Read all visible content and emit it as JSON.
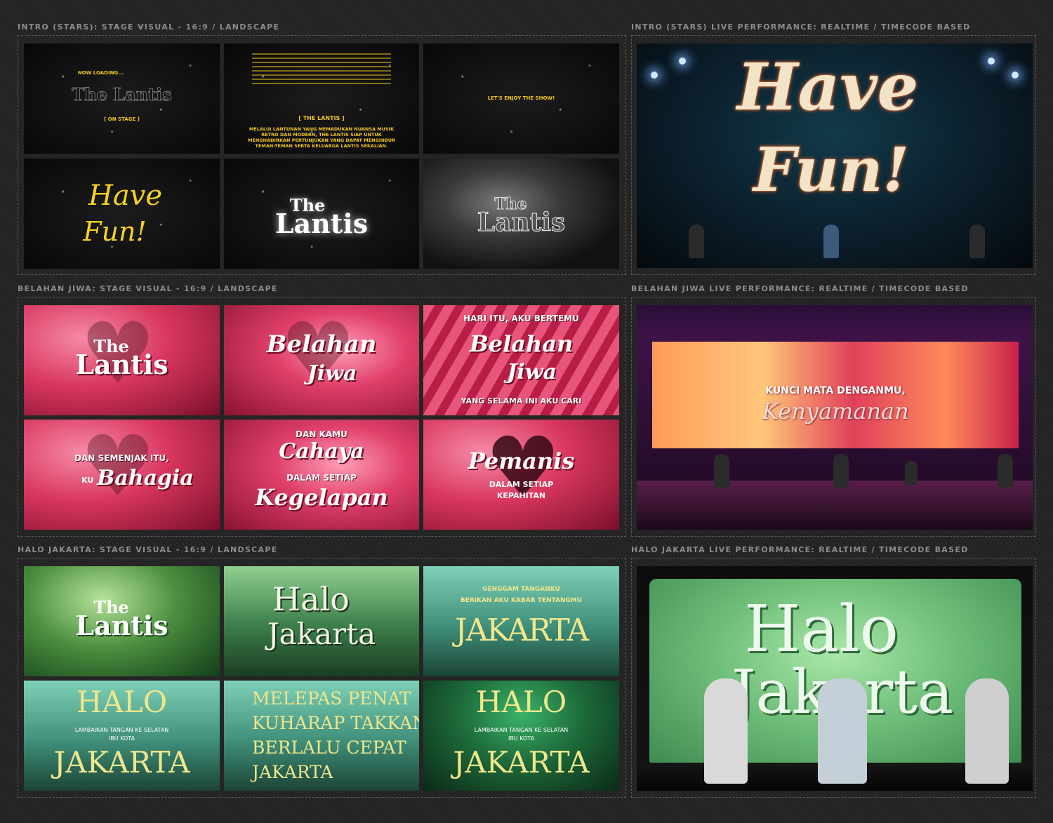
{
  "sections": {
    "intro_stage": "INTRO (STARS): STAGE VISUAL - 16:9 / LANDSCAPE",
    "intro_live": "INTRO (STARS) LIVE PERFORMANCE: REALTIME / TIMECODE BASED",
    "belahan_stage": "BELAHAN JIWA: STAGE VISUAL - 16:9 / LANDSCAPE",
    "belahan_live": "BELAHAN JIWA LIVE PERFORMANCE: REALTIME / TIMECODE BASED",
    "halo_stage": "HALO JAKARTA: STAGE VISUAL - 16:9 / LANDSCAPE",
    "halo_live": "HALO JAKARTA LIVE PERFORMANCE: REALTIME / TIMECODE BASED"
  },
  "intro": {
    "p1": {
      "loading": "NOW LOADING...",
      "logo": "The Lantis",
      "stage": "[ ON STAGE ]"
    },
    "p2": {
      "band": "[ THE LANTIS ]",
      "body": "MELALUI LANTUNAN YANG MEMADUKAN NUANSA MUSIK RETRO DAN MODERN, THE LANTIS SIAP UNTUK MENGHADIRKAN PERTUNJUKAN YANG DAPAT MENGHIBUR TEMAN-TEMAN SERTA KELUARGA LANTIS SEKALIAN."
    },
    "p3": {
      "text": "LET'S ENJOY THE SHOW!"
    },
    "p4": {
      "line1": "Have",
      "line2": "Fun!"
    },
    "p5": {
      "logo_top": "The",
      "logo_bottom": "Lantis"
    },
    "p6": {
      "logo_top": "The",
      "logo_bottom": "Lantis"
    },
    "live": {
      "line1": "Have",
      "line2": "Fun!"
    }
  },
  "belahan": {
    "p1": {
      "logo_top": "The",
      "logo_bottom": "Lantis"
    },
    "p2": {
      "line1": "Belahan",
      "line2": "Jiwa"
    },
    "p3": {
      "top": "HARI ITU, AKU BERTEMU",
      "line1": "Belahan",
      "line2": "Jiwa",
      "bottom": "YANG SELAMA INI AKU CARI"
    },
    "p4": {
      "top": "DAN SEMENJAK ITU,",
      "prefix": "KU",
      "word": "Bahagia"
    },
    "p5": {
      "top": "DAN KAMU",
      "word1": "Cahaya",
      "mid": "DALAM SETIAP",
      "word2": "Kegelapan"
    },
    "p6": {
      "word": "Pemanis",
      "line1": "DALAM SETIAP",
      "line2": "KEPAHITAN"
    },
    "live": {
      "top": "KUNCI MATA DENGANMU,",
      "word": "Kenyamanan"
    }
  },
  "halo": {
    "p1": {
      "logo_top": "The",
      "logo_bottom": "Lantis"
    },
    "p2": {
      "line1": "Halo",
      "line2": "Jakarta"
    },
    "p3": {
      "line1": "GENGGAM TANGANKU",
      "line2": "BERIKAN AKU KABAR TENTANGMU",
      "big": "JAKARTA"
    },
    "p4": {
      "big1": "HALO",
      "small1": "LAMBAIKAN TANGAN KE SELATAN",
      "small2": "IBU KOTA",
      "big2": "JAKARTA"
    },
    "p5": {
      "l1": "MELEPAS PENAT",
      "l2": "KUHARAP TAKKAN",
      "l3": "BERLALU CEPAT",
      "l4": "JAKARTA"
    },
    "p6": {
      "big1": "HALO",
      "small1": "LAMBAIKAN TANGAN KE SELATAN",
      "small2": "IBU KOTA",
      "big2": "JAKARTA"
    },
    "live": {
      "line1": "Halo",
      "line2": "Jakarta"
    }
  }
}
